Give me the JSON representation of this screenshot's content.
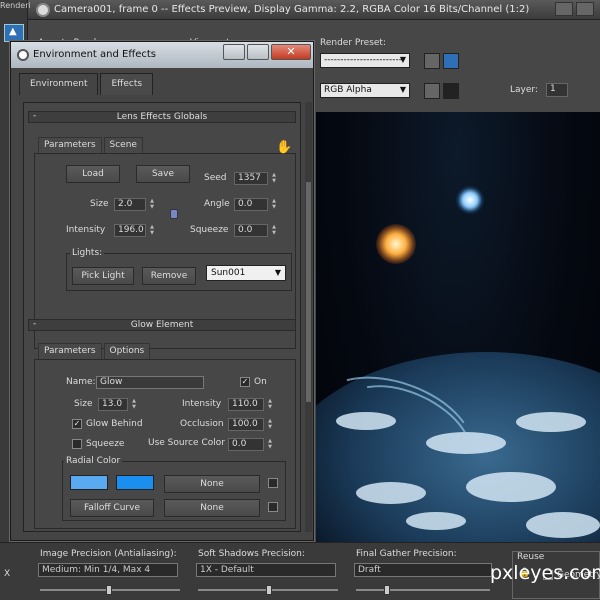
{
  "render_window": {
    "title": "Camera001, frame 0 -- Effects Preview, Display Gamma: 2.2, RGBA Color 16 Bits/Channel (1:2)",
    "left_strip_label": "Renderi",
    "area_to_render_label": "Area to Render:",
    "viewport_label": "Viewport:",
    "render_preset_label": "Render Preset:",
    "render_preset_value": "------------------------",
    "channel_value": "RGB Alpha",
    "layer_label": "Layer:",
    "layer_value": "1"
  },
  "dialog": {
    "title": "Environment and Effects",
    "close_label": "✕",
    "tabs": [
      "Environment",
      "Effects"
    ],
    "lens_globals": {
      "header": "Lens Effects Globals",
      "subtabs": [
        "Parameters",
        "Scene"
      ],
      "load_label": "Load",
      "save_label": "Save",
      "seed_label": "Seed",
      "seed_value": "1357",
      "size_label": "Size",
      "size_value": "2.0",
      "angle_label": "Angle",
      "angle_value": "0.0",
      "intensity_label": "Intensity",
      "intensity_value": "196.0",
      "squeeze_label": "Squeeze",
      "squeeze_value": "0.0",
      "lights_label": "Lights:",
      "pick_light_label": "Pick Light",
      "remove_label": "Remove",
      "light_selected": "Sun001"
    },
    "glow": {
      "header": "Glow Element",
      "subtabs": [
        "Parameters",
        "Options"
      ],
      "name_label": "Name:",
      "name_value": "Glow",
      "on_label": "On",
      "on_checked": "✓",
      "size_label": "Size",
      "size_value": "13.0",
      "intensity_label": "Intensity",
      "intensity_value": "110.0",
      "glow_behind_label": "Glow Behind",
      "glow_behind_checked": "✓",
      "occlusion_label": "Occlusion",
      "occlusion_value": "100.0",
      "squeeze_label": "Squeeze",
      "use_source_label": "Use Source Color",
      "use_source_value": "0.0",
      "radial_color_label": "Radial Color",
      "none_label_1": "None",
      "falloff_label": "Falloff Curve",
      "none_label_2": "None",
      "swatch_colors": [
        "#5aaaf2",
        "#1a8ff0"
      ]
    }
  },
  "bottom": {
    "image_precision_label": "Image Precision (Antialiasing):",
    "image_precision_value": "Medium: Min 1/4, Max 4",
    "soft_shadows_label": "Soft Shadows Precision:",
    "soft_shadows_value": "1X - Default",
    "final_gather_label": "Final Gather Precision:",
    "final_gather_value": "Draft",
    "reuse_label": "Reuse",
    "geometry_label": "Geometry",
    "x_label": "X"
  },
  "watermark": "pxleyes.com"
}
